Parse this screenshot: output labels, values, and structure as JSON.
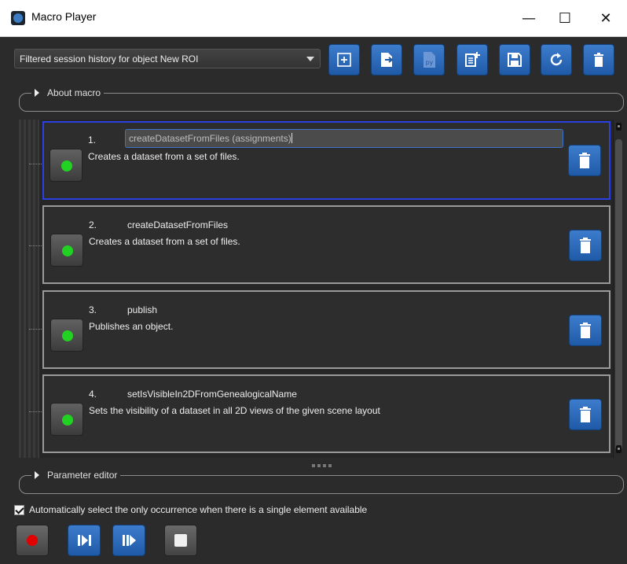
{
  "window": {
    "title": "Macro Player",
    "minimize_glyph": "—",
    "maximize_glyph": "☐",
    "close_glyph": "✕"
  },
  "toolbar": {
    "history_filter": "Filtered session history for object New ROI",
    "buttons": [
      {
        "name": "add-macro-button",
        "icon": "plus-box-icon"
      },
      {
        "name": "import-macro-button",
        "icon": "file-import-icon"
      },
      {
        "name": "export-python-button",
        "icon": "python-file-icon",
        "label": "py"
      },
      {
        "name": "new-macro-button",
        "icon": "document-add-icon"
      },
      {
        "name": "save-macro-button",
        "icon": "floppy-disk-icon"
      },
      {
        "name": "refresh-button",
        "icon": "refresh-icon"
      },
      {
        "name": "delete-all-button",
        "icon": "trash-icon"
      }
    ]
  },
  "sections": {
    "about_macro": "About macro",
    "parameter_editor": "Parameter editor"
  },
  "macro_items": [
    {
      "index": "1.",
      "name": "createDatasetFromFiles (assignments)",
      "description": "Creates a dataset from a set of files.",
      "status": "ok",
      "editing": true
    },
    {
      "index": "2.",
      "name": "createDatasetFromFiles",
      "description": "Creates a dataset from a set of files.",
      "status": "ok"
    },
    {
      "index": "3.",
      "name": "publish",
      "description": "Publishes an object.",
      "status": "ok"
    },
    {
      "index": "4.",
      "name": "setIsVisibleIn2DFromGenealogicalName",
      "description": "Sets the visibility of a dataset in all 2D views of the given scene layout",
      "status": "ok"
    }
  ],
  "options": {
    "auto_select_label": "Automatically select the only occurrence when there is a single element available",
    "auto_select_checked": true
  },
  "player_controls": [
    {
      "name": "record-button",
      "icon": "record-icon"
    },
    {
      "name": "step-forward-button",
      "icon": "step-forward-icon"
    },
    {
      "name": "play-all-button",
      "icon": "play-all-icon"
    },
    {
      "name": "stop-button",
      "icon": "stop-icon"
    }
  ],
  "colors": {
    "accent": "#2a6bbd",
    "status_ok": "#22d222",
    "record": "#e10000",
    "selection_border": "#2c3fe0"
  }
}
